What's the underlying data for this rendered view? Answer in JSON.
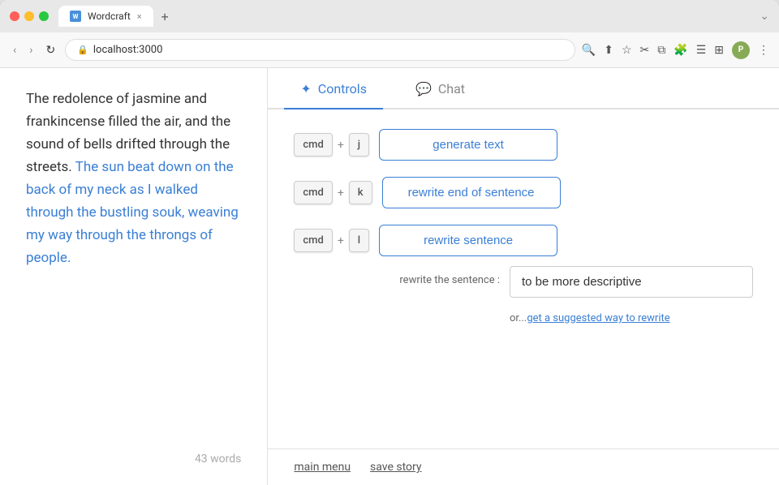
{
  "browser": {
    "tab_title": "Wordcraft",
    "tab_close": "×",
    "new_tab": "+",
    "window_expand": "⌄",
    "address": "localhost:3000",
    "nav_back": "‹",
    "nav_forward": "›",
    "nav_reload": "↻"
  },
  "editor": {
    "text_before_highlight": "The redolence of jasmine and frankincense filled the air, and the sound of bells drifted through the streets.",
    "text_highlighted": " The sun beat down on the back of my neck as I walked through the bustling souk, weaving my way through the throngs of people.",
    "word_count": "43 words"
  },
  "controls_panel": {
    "tabs": [
      {
        "id": "controls",
        "label": "Controls",
        "icon": "✦",
        "active": true
      },
      {
        "id": "chat",
        "label": "Chat",
        "icon": "💬",
        "active": false
      }
    ],
    "shortcuts": [
      {
        "id": "generate",
        "modifier": "cmd",
        "plus": "+",
        "key": "j",
        "action_label": "generate text"
      },
      {
        "id": "rewrite-end",
        "modifier": "cmd",
        "plus": "+",
        "key": "k",
        "action_label": "rewrite end of sentence"
      },
      {
        "id": "rewrite-sentence",
        "modifier": "cmd",
        "plus": "+",
        "key": "l",
        "action_label": "rewrite sentence"
      }
    ],
    "rewrite_label": "rewrite the sentence :",
    "rewrite_placeholder": "to be more descriptive",
    "rewrite_or_text": "or...",
    "rewrite_link_text": "get a suggested way to rewrite"
  },
  "bottom_bar": {
    "main_menu_label": "main menu",
    "save_story_label": "save story"
  }
}
